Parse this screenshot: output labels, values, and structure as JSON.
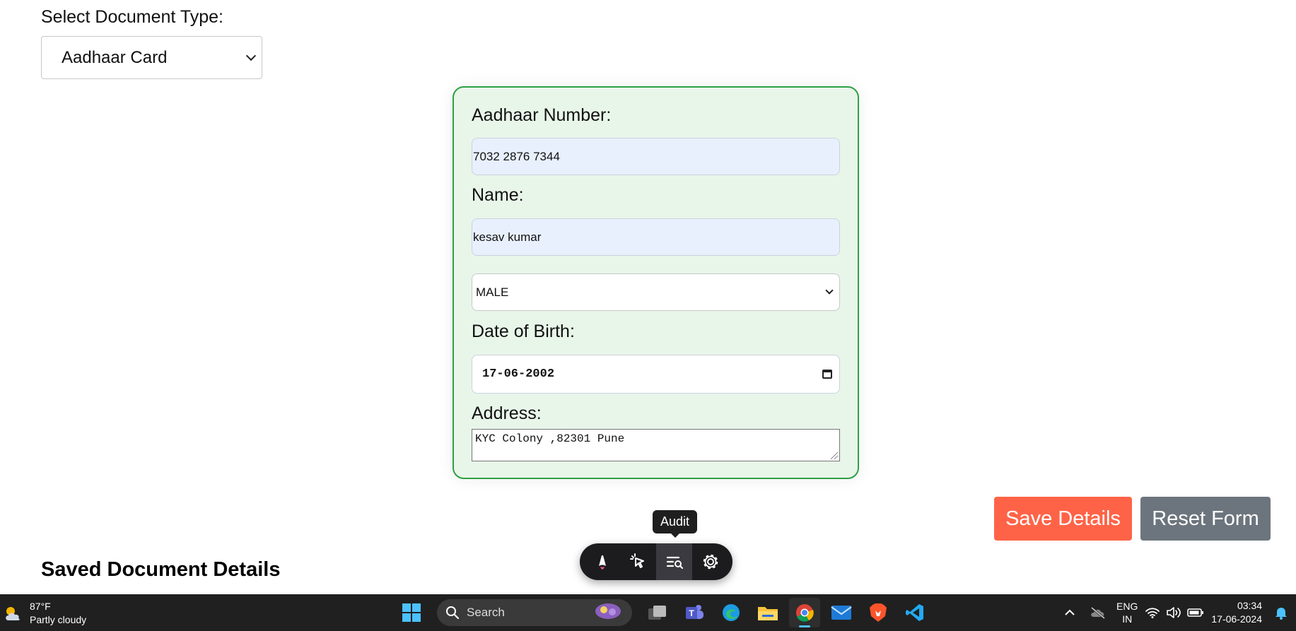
{
  "document_type": {
    "label": "Select Document Type:",
    "selected": "Aadhaar Card"
  },
  "form": {
    "aadhaar_label": "Aadhaar Number:",
    "aadhaar_value": "7032 2876 7344",
    "name_label": "Name:",
    "name_value": "kesav kumar",
    "gender_selected": "MALE",
    "dob_label": "Date of Birth:",
    "dob_value": "17-06-2002",
    "address_label": "Address:",
    "address_value": "KYC Colony ,82301 Pune"
  },
  "actions": {
    "save_label": "Save Details",
    "reset_label": "Reset Form"
  },
  "saved_heading": "Saved Document Details",
  "dev_toolbar": {
    "tooltip": "Audit",
    "tools": [
      "astro-logo-icon",
      "inspect-cursor-icon",
      "audit-icon",
      "settings-gear-icon"
    ],
    "active_tool": "audit-icon"
  },
  "taskbar": {
    "weather_temp": "87°F",
    "weather_desc": "Partly cloudy",
    "search_placeholder": "Search",
    "apps": [
      "windows-start-icon",
      "task-view-icon",
      "teams-icon",
      "edge-icon",
      "file-explorer-icon",
      "chrome-icon",
      "mail-icon",
      "brave-icon",
      "vscode-icon"
    ],
    "active_app": "chrome-icon",
    "lang_top": "ENG",
    "lang_bottom": "IN",
    "time": "03:34",
    "date": "17-06-2024"
  },
  "colors": {
    "card_bg": "#e8f5e9",
    "card_border": "#2ea043",
    "save_button": "#ff6347",
    "reset_button": "#6c757d",
    "autofill_bg": "#e8f0fe",
    "taskbar_bg": "#202020"
  }
}
